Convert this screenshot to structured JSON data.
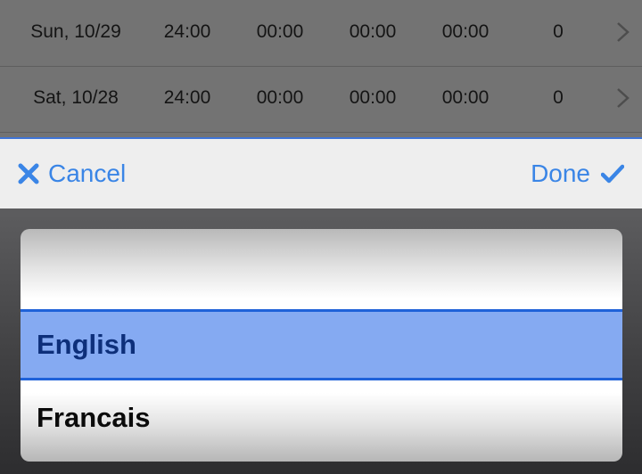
{
  "table": {
    "rows": [
      {
        "date": "Sun, 10/29",
        "total": "24:00",
        "c2": "00:00",
        "c3": "00:00",
        "c4": "00:00",
        "count": "0"
      },
      {
        "date": "Sat, 10/28",
        "total": "24:00",
        "c2": "00:00",
        "c3": "00:00",
        "c4": "00:00",
        "count": "0"
      }
    ]
  },
  "toolbar": {
    "cancel_label": "Cancel",
    "done_label": "Done"
  },
  "picker": {
    "options": [
      "English",
      "Francais"
    ],
    "selected": "English"
  },
  "colors": {
    "accent": "#3a85e6",
    "selection_fill": "#85aaf2",
    "selection_border": "#1f62d9"
  }
}
